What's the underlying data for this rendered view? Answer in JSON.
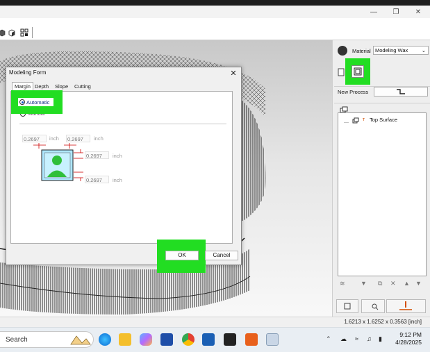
{
  "dialog": {
    "title": "Modeling Form",
    "tabs": [
      "Margin",
      "Depth",
      "Slope",
      "Cutting Area"
    ],
    "radio_auto": "Automatic",
    "radio_manual": "Manual",
    "left_value": "0.2697",
    "right_value": "0.2697",
    "top_right_value": "0.2697",
    "bottom_right_value": "0.2697",
    "unit": "inch",
    "ok": "OK",
    "cancel": "Cancel"
  },
  "panel": {
    "material_label": "Material",
    "material_value": "Modeling Wax",
    "new_process_label": "New Process",
    "tree_item": "Top Surface"
  },
  "status": {
    "dimensions": "1.6213 x 1.6252 x 0.3563 [inch]"
  },
  "taskbar": {
    "search": "Search",
    "time": "9:12 PM",
    "date": "4/28/2025"
  },
  "colors": {
    "highlight": "#22dd22",
    "radio_accent": "#0a58c6"
  }
}
